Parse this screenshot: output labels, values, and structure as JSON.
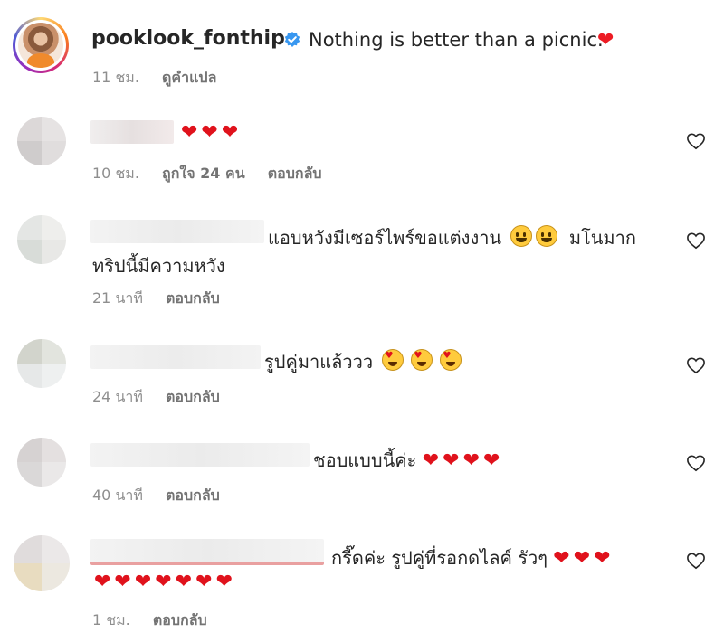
{
  "post": {
    "username": "pooklook_fonthip",
    "caption": "Nothing is better than a picnic.",
    "time": "11 ชม.",
    "translate_label": "ดูคำแปล",
    "icons": {
      "verified": "verified-badge-icon",
      "heart": "red-heart-emoji"
    }
  },
  "comments": [
    {
      "text": "",
      "emoji": "❤❤❤",
      "time": "10 ชม.",
      "likes": "ถูกใจ 24 คน",
      "reply": "ตอบกลับ"
    },
    {
      "text": "แอบหวังมีเซอร์ไพร์ขอแต่งงาน",
      "text_after": "มโนมาก",
      "line2": "ทริปนี้มีความหวัง",
      "emoji_icons": [
        "grinning-face-emoji",
        "grinning-face-emoji"
      ],
      "time": "21 นาที",
      "reply": "ตอบกลับ"
    },
    {
      "text": "รูปคู่มาแล้ววว",
      "emoji_icons": [
        "heart-eyes-emoji",
        "heart-eyes-emoji",
        "heart-eyes-emoji"
      ],
      "time": "24 นาที",
      "reply": "ตอบกลับ"
    },
    {
      "text": "ชอบแบบนี้ค่ะ",
      "emoji": "❤❤❤❤",
      "time": "40 นาที",
      "reply": "ตอบกลับ"
    },
    {
      "text": "กรี๊ดค่ะ รูปคู่ที่รอกดไลค์ รัวๆ",
      "emoji": "❤❤❤",
      "line2_emoji": "❤❤❤❤❤❤❤",
      "time": "1 ชม.",
      "reply": "ตอบกลับ"
    }
  ],
  "colors": {
    "text": "#262626",
    "muted": "#8e8e8e",
    "heart": "#e0121c",
    "verified": "#3897f0"
  }
}
